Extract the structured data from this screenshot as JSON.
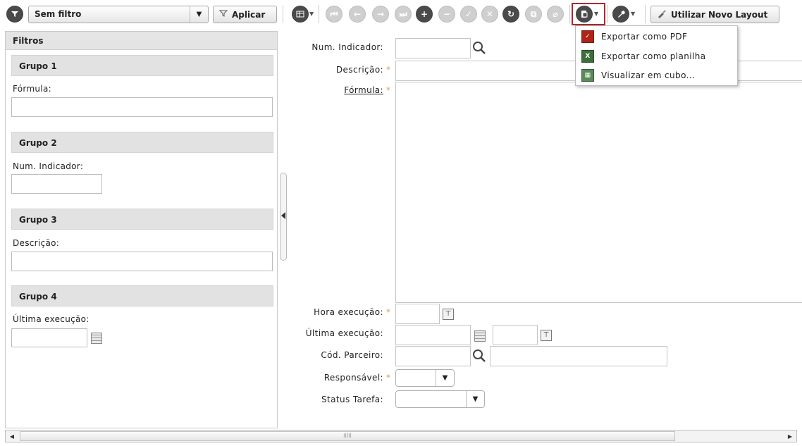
{
  "toolbar": {
    "filter_select_value": "Sem filtro",
    "apply_label": "Aplicar",
    "new_layout_label": "Utilizar Novo Layout"
  },
  "filters": {
    "title": "Filtros",
    "groups": [
      {
        "header": "Grupo 1",
        "field_label": "Fórmula:"
      },
      {
        "header": "Grupo 2",
        "field_label": "Num. Indicador:"
      },
      {
        "header": "Grupo 3",
        "field_label": "Descrição:"
      },
      {
        "header": "Grupo 4",
        "field_label": "Última execução:"
      }
    ]
  },
  "form": {
    "num_indicador_label": "Num. Indicador:",
    "descricao_label": "Descrição:",
    "formula_label": "Fórmula:",
    "hora_execucao_label": "Hora execução:",
    "ultima_execucao_label": "Última execução:",
    "cod_parceiro_label": "Cód. Parceiro:",
    "responsavel_label": "Responsável:",
    "status_tarefa_label": "Status Tarefa:",
    "required_mark": "*"
  },
  "export_menu": {
    "items": [
      {
        "label": "Exportar como PDF",
        "icon": "pdf-icon"
      },
      {
        "label": "Exportar como planilha",
        "icon": "spreadsheet-icon"
      },
      {
        "label": "Visualizar em cubo...",
        "icon": "cube-icon"
      }
    ]
  },
  "scrollbar": {
    "grip": "IIIII"
  },
  "colors": {
    "highlight": "#b3262a",
    "required": "#c8a06a"
  }
}
